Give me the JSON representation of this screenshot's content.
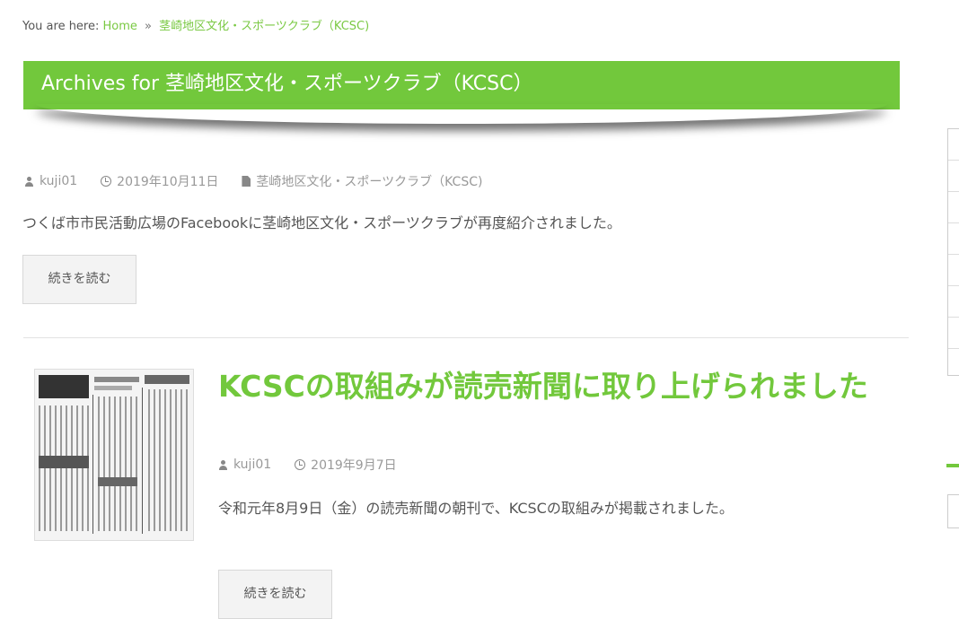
{
  "breadcrumb": {
    "prefix": "You are here:",
    "home": "Home",
    "separator": "»",
    "current": "茎崎地区文化・スポーツクラブ（KCSC)"
  },
  "archive": {
    "title": "Archives for 茎崎地区文化・スポーツクラブ（KCSC）"
  },
  "posts": [
    {
      "author": "kuji01",
      "date": "2019年10月11日",
      "category": "茎崎地区文化・スポーツクラブ（KCSC)",
      "excerpt": "つくば市市民活動広場のFacebookに茎崎地区文化・スポーツクラブが再度紹介されました。",
      "read_more": "続きを読む"
    },
    {
      "title": "KCSCの取組みが読売新聞に取り上げられました",
      "author": "kuji01",
      "date": "2019年9月7日",
      "excerpt": "令和元年8月9日（金）の読売新聞の朝刊で、KCSCの取組みが掲載されました。",
      "read_more": "続きを読む"
    }
  ],
  "icons": {
    "author": "user-icon",
    "date": "clock-icon",
    "category": "folder-icon"
  },
  "colors": {
    "accent": "#72c83c",
    "link": "#7ac943",
    "text": "#555555",
    "meta": "#999999"
  }
}
